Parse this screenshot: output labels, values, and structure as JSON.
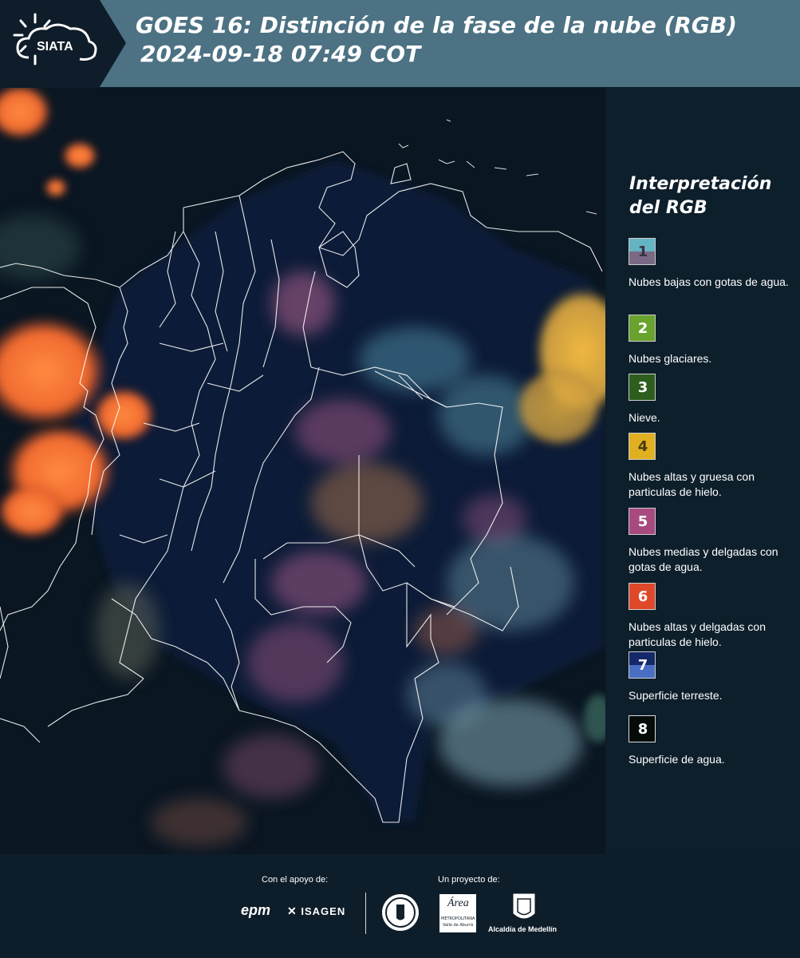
{
  "header": {
    "logo_text": "SIATA",
    "title_line1": "GOES 16: Distinción de la fase de la nube (RGB)",
    "title_line2": "2024-09-18 07:49 COT",
    "background_color": "#4c7283"
  },
  "legend": {
    "title": "Interpretación del RGB",
    "items": [
      {
        "number": "1",
        "label": "Nubes bajas con gotas de agua.",
        "color_top": "#64b4c4",
        "color_bottom": "#7a6a86"
      },
      {
        "number": "2",
        "label": "Nubes glaciares.",
        "color_top": "#6aa22e",
        "color_bottom": "#6aa22e"
      },
      {
        "number": "3",
        "label": "Nieve.",
        "color_top": "#2e5e1e",
        "color_bottom": "#2e5e1e"
      },
      {
        "number": "4",
        "label": "Nubes altas y gruesa con particulas de hielo.",
        "color_top": "#e0b020",
        "color_bottom": "#e0b020"
      },
      {
        "number": "5",
        "label": "Nubes medias y delgadas con gotas de agua.",
        "color_top": "#a84a80",
        "color_bottom": "#a84a80"
      },
      {
        "number": "6",
        "label": "Nubes altas y delgadas con particulas de hielo.",
        "color_top": "#e0482a",
        "color_bottom": "#e0482a"
      },
      {
        "number": "7",
        "label": "Superficie terreste.",
        "color_top": "#14286a",
        "color_bottom": "#4a6ec4"
      },
      {
        "number": "8",
        "label": "Superficie de agua.",
        "color_top": "#050c08",
        "color_bottom": "#050c08"
      }
    ]
  },
  "footer": {
    "support_label": "Con el apoyo de:",
    "project_label": "Un proyecto de:",
    "epm_logo": "epm",
    "isagen_logo": "ISAGEN",
    "area_logo_main": "Área",
    "area_logo_sub1": "METROPOLITANA",
    "area_logo_sub2": "Valle de Aburrá",
    "alcaldia_logo": "Alcaldía de Medellín"
  }
}
